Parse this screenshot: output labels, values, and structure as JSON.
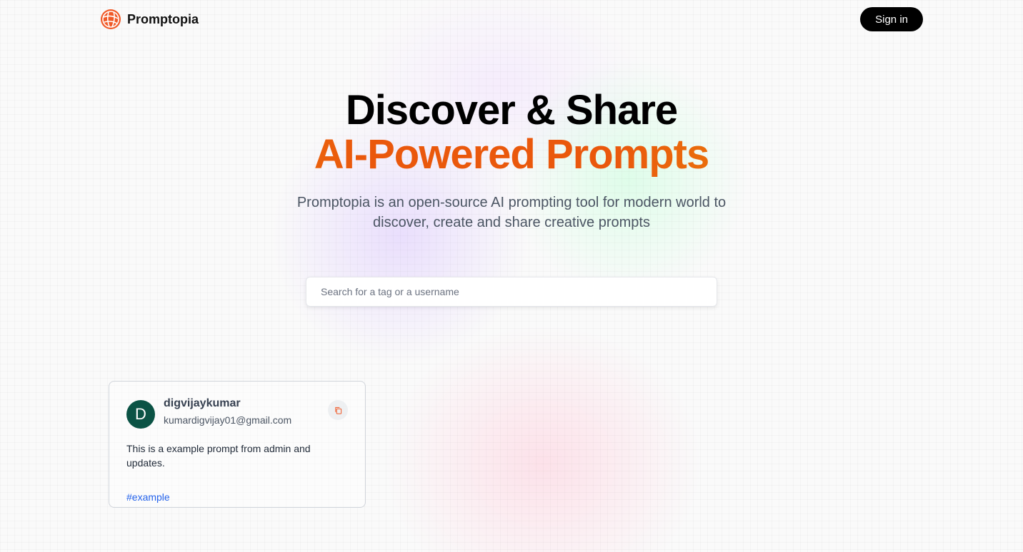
{
  "nav": {
    "brand": "Promptopia",
    "sign_in_label": "Sign in"
  },
  "hero": {
    "title_line1": "Discover & Share",
    "title_line2": "AI-Powered Prompts",
    "subtitle": "Promptopia is an open-source AI prompting tool for modern world to discover, create and share creative prompts"
  },
  "search": {
    "placeholder": "Search for a tag or a username",
    "value": ""
  },
  "prompts": [
    {
      "avatar_letter": "D",
      "username": "digvijaykumar",
      "email": "kumardigvijay01@gmail.com",
      "text": "This is a example prompt from admin and updates.",
      "tag": "#example",
      "copy_icon": "copy-icon"
    }
  ],
  "colors": {
    "accent_orange": "#ea580c",
    "tag_blue": "#2563eb",
    "avatar_green": "#0b5345"
  }
}
